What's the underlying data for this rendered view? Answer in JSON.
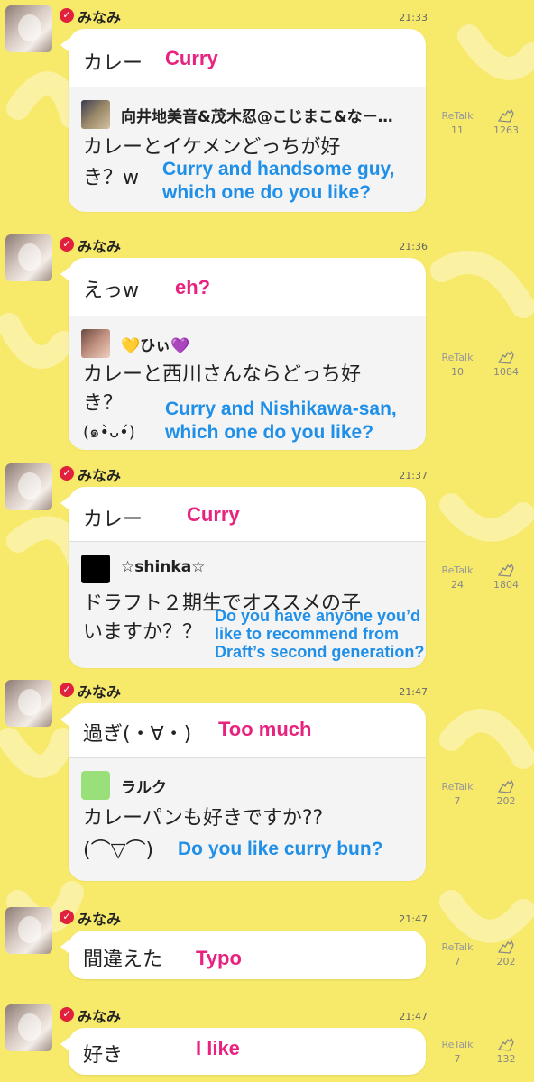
{
  "colors": {
    "background": "#f7e96a",
    "annotation_pink": "#e8227f",
    "annotation_blue": "#1f8fe8",
    "verified": "#e0203c"
  },
  "labels": {
    "retalk": "ReTalk"
  },
  "posts": [
    {
      "user": "みなみ",
      "time": "21:33",
      "message": "カレー",
      "annotation": "Curry",
      "reply": {
        "name": "向井地美音&茂木忍@こじまこ&なー…",
        "text_line1": "カレーとイケメンどっちが好",
        "text_line2": "き？w",
        "annotation_line1": "Curry and handsome guy,",
        "annotation_line2": "which one do you like?"
      },
      "retalk": "11",
      "applause": "1263"
    },
    {
      "user": "みなみ",
      "time": "21:36",
      "message": "えっw",
      "annotation": "eh?",
      "reply": {
        "name": "💛ひぃ💜",
        "text_line1": "カレーと西川さんならどっち好",
        "text_line2": "き？",
        "text_line3": "(๑•̀ᴗ•́)",
        "annotation_line1": "Curry and Nishikawa-san,",
        "annotation_line2": "which one do you like?"
      },
      "retalk": "10",
      "applause": "1084"
    },
    {
      "user": "みなみ",
      "time": "21:37",
      "message": "カレー",
      "annotation": "Curry",
      "reply": {
        "name": "☆shinka☆",
        "text_line1": "ドラフト２期生でオススメの子",
        "text_line2": "いますか？？",
        "annotation_line1": "Do you have anyone you’d",
        "annotation_line2": "like to recommend from",
        "annotation_line3": "Draft’s second generation?"
      },
      "retalk": "24",
      "applause": "1804"
    },
    {
      "user": "みなみ",
      "time": "21:47",
      "message": "過ぎ(・∀・)",
      "annotation": "Too much",
      "reply": {
        "name": "ラルク",
        "text_line1": "カレーパンも好きですか??",
        "text_line2": "(⌒▽⌒)",
        "annotation_line1": "Do you like curry bun?"
      },
      "retalk": "7",
      "applause": "202"
    },
    {
      "user": "みなみ",
      "time": "21:47",
      "message": "間違えた",
      "annotation": "Typo",
      "retalk": "7",
      "applause": "202"
    },
    {
      "user": "みなみ",
      "time": "21:47",
      "message": "好き",
      "annotation": "I like",
      "retalk": "7",
      "applause": "132"
    }
  ]
}
